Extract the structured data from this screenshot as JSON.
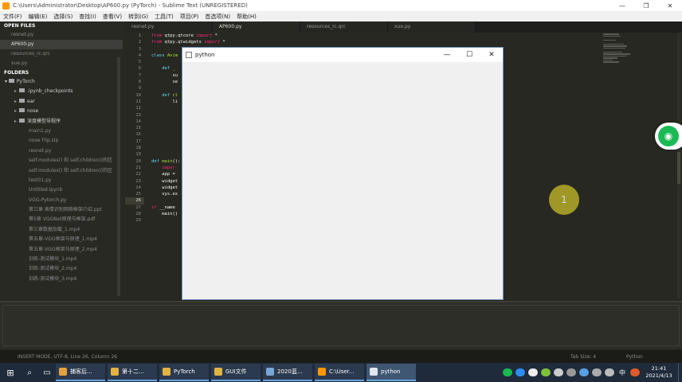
{
  "window": {
    "title": "C:\\Users\\Administrator\\Desktop\\AP600.py (PyTorch) - Sublime Text (UNREGISTERED)",
    "minimize": "—",
    "maximize": "❐",
    "close": "✕"
  },
  "menu": [
    "文件(F)",
    "编辑(E)",
    "选择(S)",
    "查找(I)",
    "查看(V)",
    "转到(G)",
    "工具(T)",
    "项目(P)",
    "首选项(N)",
    "帮助(H)"
  ],
  "sidebar": {
    "open_files_header": "OPEN FILES",
    "open_files": [
      "resnet.py",
      "AP600.py",
      "resources_rc.qrc",
      "xue.py"
    ],
    "active_file_index": 1,
    "folders_header": "FOLDERS",
    "root": "PyTorch",
    "subfolders": [
      ".ipynb_checkpoints",
      "ear",
      "nose",
      "深度模型导程序"
    ],
    "files": [
      "main1.py",
      "nose Flip.zip",
      "resnet.py",
      "self.modules() 和 self.children()的区",
      "self.modules() 和 self.children()的区",
      "test01.py",
      "Untitled.ipynb",
      "VGG-Pytorch.py",
      "第三章 表情识别网络框架介绍.ppt",
      "第5章 VGGNet原理与框架.pdf",
      "第三章数据加载_1.mp4",
      "第五章-VGG框架与原理_1.mp4",
      "第五章-VGG框架与原理_2.mp4",
      "训练-测试模块_1.mp4",
      "训练-测试模块_2.mp4",
      "训练-测试模块_3.mp4"
    ]
  },
  "tabs": [
    "resnet.py",
    "AP600.py",
    "resources_rc.qrc",
    "xue.py"
  ],
  "active_tab_index": 1,
  "line_numbers": [
    "1",
    "2",
    "3",
    "4",
    "5",
    "6",
    "7",
    "8",
    "9",
    "10",
    "11",
    "12",
    "13",
    "14",
    "15",
    "16",
    "17",
    "18",
    "19",
    "20",
    "21",
    "22",
    "23",
    "24",
    "25",
    "26",
    "27",
    "28",
    "29"
  ],
  "highlight_line": "26",
  "code": {
    "l1_from": "from",
    "l1_mod": " qtpy.qtcore ",
    "l1_imp": "import",
    "l1_rest": " *",
    "l2_from": "from",
    "l2_mod": " qtpy.qtwidgets ",
    "l2_imp": "import",
    "l2_rest": " *",
    "l4_cls": "class",
    "l4_name": " Anim",
    "l6_def": "def",
    "l6_rest": " _",
    "l7": "su",
    "l8": "se",
    "l10_def": "def",
    "l10_rest": " cl",
    "l11": "li",
    "l20_def": "def",
    "l20_name": " main",
    "l20_rest": "():",
    "l21": "impor",
    "l22": "app =",
    "l23": "widget",
    "l24": "widget",
    "l25": "sys.ex",
    "l27_if": "if",
    "l27_rest": " __name",
    "l28": "main()"
  },
  "status": {
    "left": "INSERT MODE, UTF-8, Line 26, Column 26",
    "tab_size": "Tab Size: 4",
    "syntax": "Python"
  },
  "python_window": {
    "title": "python",
    "minimize": "—",
    "maximize": "☐",
    "close": "✕"
  },
  "cursor_marker": "1",
  "taskbar": {
    "items": [
      "捕客后...",
      "第十二...",
      "PyTorch",
      "GUI文件",
      "2020蓝...",
      "C:\\User...",
      "python"
    ],
    "active_index": 6,
    "ime": "中",
    "time": "21:41",
    "date": "2021/4/13"
  },
  "colors": {
    "keyword": "#f92672",
    "function": "#a6e22e",
    "accent_blue": "#66d9ef",
    "task_accent": "#6aa3d8",
    "wechat_green": "#19b954",
    "cursor_yellow": "#c8be28"
  },
  "icons": {
    "start": "windows-start-icon",
    "search": "search-icon",
    "taskview": "task-view-icon",
    "wifi": "wifi-icon"
  }
}
